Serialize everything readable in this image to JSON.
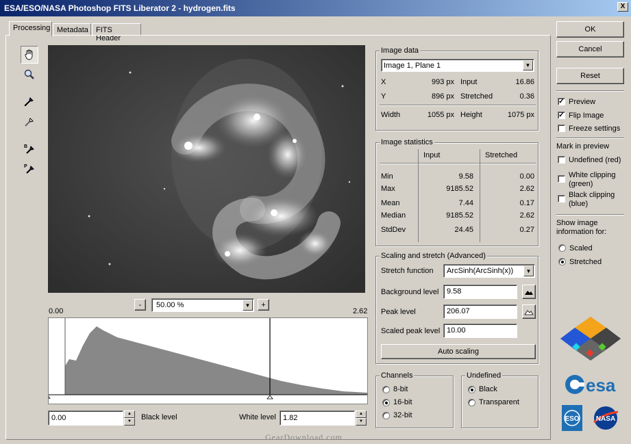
{
  "window": {
    "title": "ESA/ESO/NASA Photoshop FITS Liberator 2 - hydrogen.fits",
    "close_glyph": "X"
  },
  "tabs": [
    {
      "label": "Processing",
      "active": true
    },
    {
      "label": "Metadata",
      "active": false
    },
    {
      "label": "FITS Header",
      "active": false
    }
  ],
  "tools": [
    "hand-icon",
    "zoom-icon",
    "eyedropper-icon",
    "eyedropper-alt-icon",
    "black-point-picker-icon",
    "peak-picker-icon"
  ],
  "zoom": {
    "minus": "-",
    "plus": "+",
    "value": "50.00 %"
  },
  "histogram": {
    "left_value": "0.00",
    "right_value": "2.62",
    "white_marker_fraction": 0.694
  },
  "levels": {
    "black_value": "0.00",
    "black_label": "Black level",
    "white_label": "White level",
    "white_value": "1.82"
  },
  "image_data": {
    "title": "Image data",
    "plane": "Image 1, Plane 1",
    "x_label": "X",
    "x_value": "993 px",
    "input_label": "Input",
    "input_value": "16.86",
    "y_label": "Y",
    "y_value": "896 px",
    "stretched_label": "Stretched",
    "stretched_value": "0.36",
    "width_label": "Width",
    "width_value": "1055 px",
    "height_label": "Height",
    "height_value": "1075 px"
  },
  "image_stats": {
    "title": "Image statistics",
    "col_input": "Input",
    "col_stretched": "Stretched",
    "rows": [
      {
        "label": "Min",
        "input": "9.58",
        "stretched": "0.00"
      },
      {
        "label": "Max",
        "input": "9185.52",
        "stretched": "2.62"
      },
      {
        "label": "Mean",
        "input": "7.44",
        "stretched": "0.17"
      },
      {
        "label": "Median",
        "input": "9185.52",
        "stretched": "2.62"
      },
      {
        "label": "StdDev",
        "input": "24.45",
        "stretched": "0.27"
      }
    ]
  },
  "scaling": {
    "title": "Scaling and stretch (Advanced)",
    "stretch_label": "Stretch function",
    "stretch_value": "ArcSinh(ArcSinh(x))",
    "bg_label": "Background level",
    "bg_value": "9.58",
    "peak_label": "Peak level",
    "peak_value": "206.07",
    "scaled_peak_label": "Scaled peak level",
    "scaled_peak_value": "10.00",
    "auto_label": "Auto scaling"
  },
  "channels": {
    "title": "Channels",
    "options": [
      {
        "label": "8-bit",
        "selected": false
      },
      {
        "label": "16-bit",
        "selected": true
      },
      {
        "label": "32-bit",
        "selected": false
      }
    ]
  },
  "undefined_group": {
    "title": "Undefined",
    "options": [
      {
        "label": "Black",
        "selected": true
      },
      {
        "label": "Transparent",
        "selected": false
      }
    ]
  },
  "right": {
    "ok": "OK",
    "cancel": "Cancel",
    "reset": "Reset",
    "preview": {
      "label": "Preview",
      "checked": true
    },
    "flip": {
      "label": "Flip Image",
      "checked": true
    },
    "freeze": {
      "label": "Freeze settings",
      "checked": false
    },
    "mark_title": "Mark in preview",
    "undefined_red": {
      "label": "Undefined (red)",
      "checked": false
    },
    "white_clip": {
      "label": "White clipping (green)",
      "checked": false
    },
    "black_clip": {
      "label": "Black clipping (blue)",
      "checked": false
    },
    "show_title": "Show image information for:",
    "scaled": {
      "label": "Scaled",
      "selected": false
    },
    "stretched": {
      "label": "Stretched",
      "selected": true
    }
  },
  "logos": {
    "esa": "esa",
    "eso": "ESO",
    "nasa": "NASA"
  },
  "watermark": "GearDownload.com",
  "colors": {
    "title_start": "#0a246a",
    "title_end": "#a6caf0",
    "face": "#d4d0c8",
    "histogram": "#888888"
  }
}
